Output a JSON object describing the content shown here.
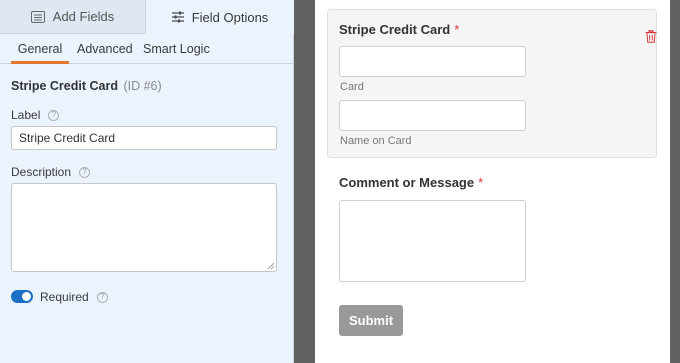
{
  "sidebar": {
    "tabs": {
      "add_fields": "Add Fields",
      "field_options": "Field Options"
    },
    "subtabs": {
      "general": "General",
      "advanced": "Advanced",
      "smart_logic": "Smart Logic"
    },
    "field": {
      "name": "Stripe Credit Card",
      "id_text": "(ID #6)"
    },
    "label_section": {
      "label": "Label",
      "value": "Stripe Credit Card"
    },
    "description_section": {
      "label": "Description",
      "value": ""
    },
    "required": {
      "label": "Required",
      "enabled": true
    },
    "help_glyph": "?"
  },
  "preview": {
    "stripe_field": {
      "title": "Stripe Credit Card",
      "required_mark": "*",
      "card_sublabel": "Card",
      "name_sublabel": "Name on Card"
    },
    "comment_field": {
      "title": "Comment or Message",
      "required_mark": "*"
    },
    "submit_label": "Submit"
  },
  "colors": {
    "accent_tab": "#e27730",
    "toggle_on": "#1b6fc7",
    "required": "#d63638",
    "submit_bg": "#999999"
  }
}
